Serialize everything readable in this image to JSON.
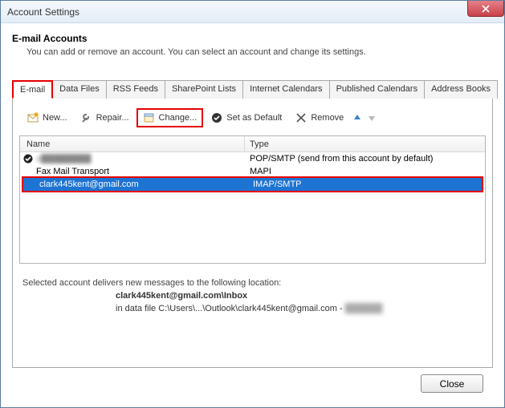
{
  "window": {
    "title": "Account Settings"
  },
  "header": {
    "heading": "E-mail Accounts",
    "subtext": "You can add or remove an account. You can select an account and change its settings."
  },
  "tabs": [
    {
      "label": "E-mail",
      "active": true
    },
    {
      "label": "Data Files"
    },
    {
      "label": "RSS Feeds"
    },
    {
      "label": "SharePoint Lists"
    },
    {
      "label": "Internet Calendars"
    },
    {
      "label": "Published Calendars"
    },
    {
      "label": "Address Books"
    }
  ],
  "toolbar": {
    "new": "New...",
    "repair": "Repair...",
    "change": "Change...",
    "setdefault": "Set as Default",
    "remove": "Remove"
  },
  "columns": {
    "name": "Name",
    "type": "Type"
  },
  "rows": [
    {
      "name": "a████████",
      "type": "POP/SMTP (send from this account by default)",
      "default": true,
      "blur": true
    },
    {
      "name": "Fax Mail Transport",
      "type": "MAPI"
    },
    {
      "name": "clark445kent@gmail.com",
      "type": "IMAP/SMTP",
      "selected": true
    }
  ],
  "location": {
    "intro": "Selected account delivers new messages to the following location:",
    "line1": "clark445kent@gmail.com\\Inbox",
    "line2_prefix": "in data file C:\\Users\\...\\Outlook\\clark445kent@gmail.com - ",
    "line2_blur": "██████"
  },
  "footer": {
    "close": "Close"
  }
}
